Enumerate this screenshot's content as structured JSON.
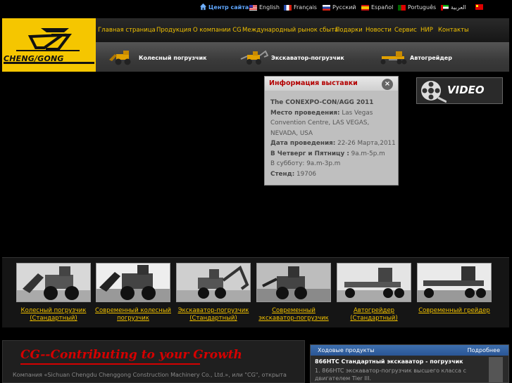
{
  "topbar": {
    "center_link": "Центр сайта",
    "languages": [
      {
        "label": "English",
        "flag": "us-flag-icon"
      },
      {
        "label": "Français",
        "flag": "fr-flag-icon"
      },
      {
        "label": "Русский",
        "flag": "ru-flag-icon"
      },
      {
        "label": "Español",
        "flag": "es-flag-icon"
      },
      {
        "label": "Português",
        "flag": "pt-flag-icon"
      },
      {
        "label": "العربية",
        "flag": "ae-flag-icon"
      },
      {
        "label": "",
        "flag": "cn-flag-icon"
      }
    ]
  },
  "logo": {
    "text": "CHENG/GONG"
  },
  "nav": {
    "items": [
      "Главная страница",
      "Продукция",
      "О компании CG",
      "Международный рынок сбыта",
      "Подарки",
      "Новости",
      "Сервис",
      "НИР",
      "Контакты"
    ]
  },
  "subnav": {
    "items": [
      "Колесный погрузчик",
      "Экскаватор-погрузчик",
      "Автогрейдер"
    ]
  },
  "exhibit": {
    "title": "Информация выставки",
    "close": "×",
    "event_name": "The CONEXPO-CON/AGG 2011",
    "venue_label": "Место проведения:",
    "venue_value": "Las Vegas Convention Centre, LAS VEGAS, NEVADA, USA",
    "date_label": "Дата проведения:",
    "date_value": "22-26 Марта,2011",
    "hours1_label": "В Четверг и Пятницу :",
    "hours1_value": "9a.m-5p.m",
    "hours2": "В субботу: 9a.m-3p.m",
    "stand_label": "Стенд:",
    "stand_value": "19706"
  },
  "video": {
    "label": "VIDEO"
  },
  "gallery": {
    "items": [
      {
        "label": "Колесный погрузчик (Стандартный)"
      },
      {
        "label": "Современный колесный погрузчик"
      },
      {
        "label": "Экскаватор-погрузчик (Стандартный)"
      },
      {
        "label": "Современный экскаватор-погрузчик"
      },
      {
        "label": "Автогрейдер (Стандартный)"
      },
      {
        "label": "Современный грейдер"
      }
    ]
  },
  "bottom": {
    "slogan": "CG--Contributing to your Growth",
    "company_text": "Компания «Sichuan Chengdu Chenggong Construction Machinery Co., Ltd.», или \"CG\", открыта"
  },
  "products": {
    "title": "Ходовые продукты",
    "more": "Подробнее",
    "name": "866HTC Стандартный экскаватор - погрузчик",
    "desc": "1. 866HTC экскаватор-погрузчик высшего класса с двигателем Tier III."
  },
  "colors": {
    "accent_yellow": "#f5c600",
    "nav_text": "#f0c000",
    "alert_red": "#b30000",
    "link_blue": "#5fa7ff"
  }
}
